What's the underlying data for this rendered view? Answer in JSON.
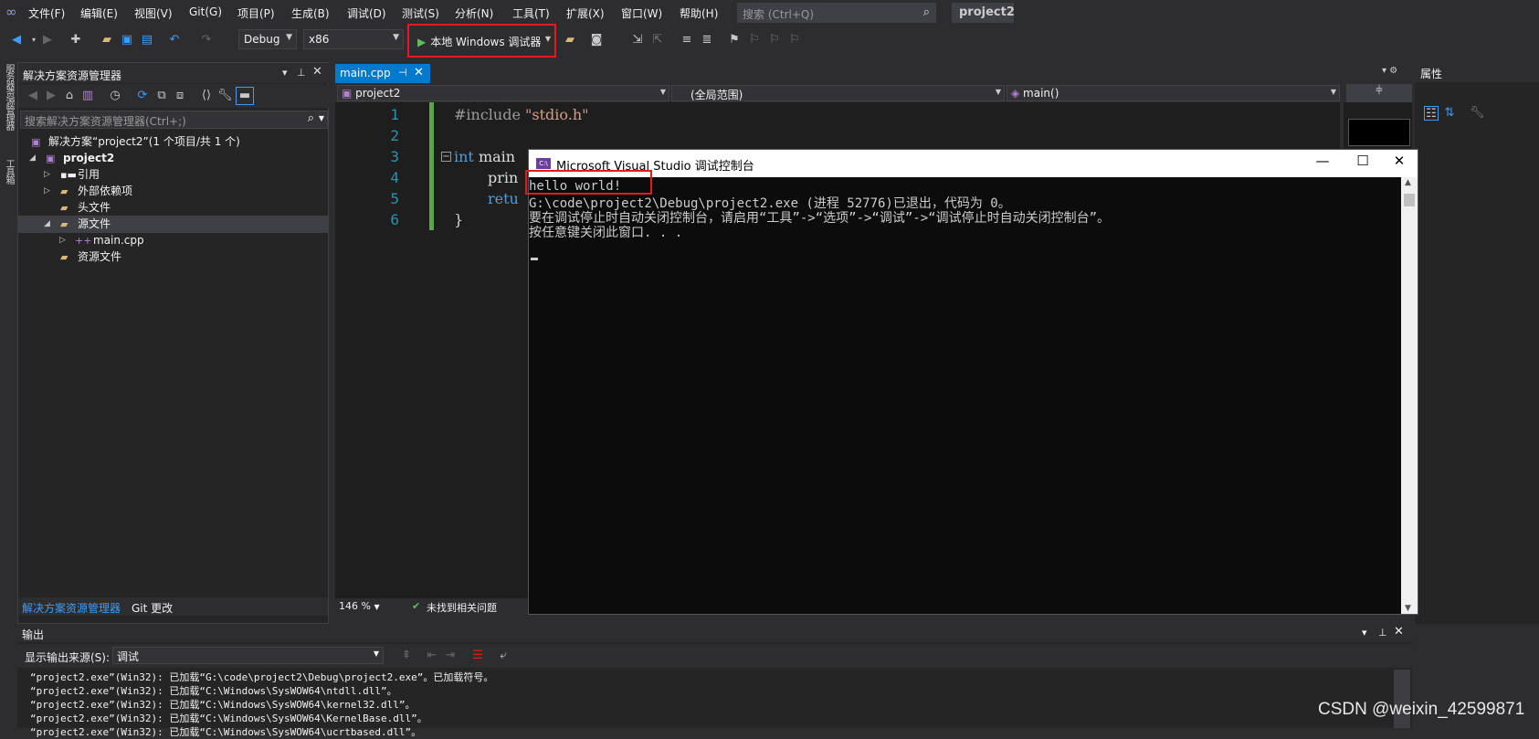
{
  "menubar": {
    "items": [
      "文件(F)",
      "编辑(E)",
      "视图(V)",
      "Git(G)",
      "项目(P)",
      "生成(B)",
      "调试(D)",
      "测试(S)",
      "分析(N)",
      "工具(T)",
      "扩展(X)",
      "窗口(W)",
      "帮助(H)"
    ],
    "search_placeholder": "搜索 (Ctrl+Q)",
    "solution_name": "project2"
  },
  "toolbar": {
    "config": "Debug",
    "platform": "x86",
    "run_label": "本地 Windows 调试器"
  },
  "left_strip": {
    "tab1": "服务器资源管理器",
    "tab2": "工具箱"
  },
  "solution_explorer": {
    "title": "解决方案资源管理器",
    "search_placeholder": "搜索解决方案资源管理器(Ctrl+;)",
    "tree": [
      {
        "label": "解决方案“project2”(1 个项目/共 1 个)"
      },
      {
        "label": "project2"
      },
      {
        "label": "引用"
      },
      {
        "label": "外部依赖项"
      },
      {
        "label": "头文件"
      },
      {
        "label": "源文件"
      },
      {
        "label": "main.cpp"
      },
      {
        "label": "资源文件"
      }
    ],
    "tabs": [
      "解决方案资源管理器",
      "Git 更改"
    ]
  },
  "editor": {
    "tab_label": "main.cpp",
    "nav_project": "project2",
    "nav_scope": "(全局范围)",
    "nav_member": "main()",
    "line_numbers": [
      "1",
      "2",
      "3",
      "4",
      "5",
      "6"
    ],
    "code": {
      "l1_directive": "#include ",
      "l1_string": "\"stdio.h\"",
      "l3_kw": "int",
      "l3_rest": " main",
      "l4": "prin",
      "l5": "retu",
      "l6": "}"
    },
    "zoom": "146 %",
    "issues": "未找到相关问题"
  },
  "console": {
    "title": "Microsoft Visual Studio 调试控制台",
    "lines": [
      "hello world!",
      "G:\\code\\project2\\Debug\\project2.exe (进程 52776)已退出，代码为 0。",
      "要在调试停止时自动关闭控制台，请启用“工具”->“选项”->“调试”->“调试停止时自动关闭控制台”。",
      "按任意键关闭此窗口. . ."
    ]
  },
  "properties": {
    "title": "属性"
  },
  "output": {
    "title": "输出",
    "source_label": "显示输出来源(S):",
    "source_value": "调试",
    "lines": [
      "“project2.exe”(Win32): 已加载“G:\\code\\project2\\Debug\\project2.exe”。已加载符号。",
      "“project2.exe”(Win32): 已加载“C:\\Windows\\SysWOW64\\ntdll.dll”。",
      "“project2.exe”(Win32): 已加载“C:\\Windows\\SysWOW64\\kernel32.dll”。",
      "“project2.exe”(Win32): 已加载“C:\\Windows\\SysWOW64\\KernelBase.dll”。",
      "“project2.exe”(Win32): 已加载“C:\\Windows\\SysWOW64\\ucrtbased.dll”。"
    ]
  },
  "watermark": "CSDN @weixin_42599871",
  "colors": {
    "accent": "#007acc",
    "highlight_red": "#e51b1b",
    "editor_bg": "#1e1e1e",
    "chrome_bg": "#2d2d30",
    "keyword": "#569cd6",
    "string": "#d69d85",
    "line_number": "#2b91af"
  }
}
